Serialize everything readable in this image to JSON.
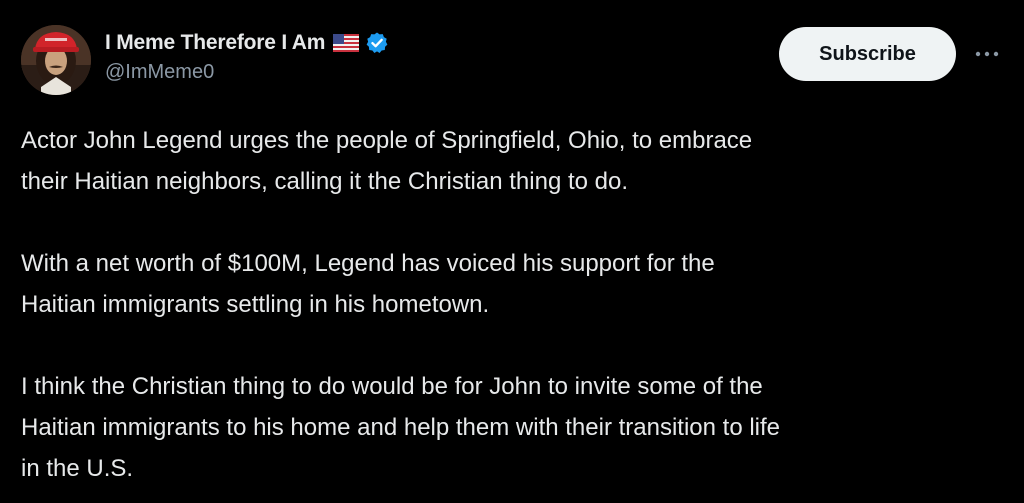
{
  "author": {
    "display_name": "I Meme Therefore I Am",
    "handle": "@ImMeme0",
    "flag_icon": "us-flag-icon",
    "verified_icon": "verified-badge-icon",
    "verified_color": "#1d9bf0"
  },
  "actions": {
    "subscribe_label": "Subscribe",
    "more_icon": "more-horizontal-icon"
  },
  "post": {
    "paragraphs": [
      "Actor John Legend urges the people of Springfield, Ohio, to embrace\ntheir Haitian neighbors, calling it the Christian thing to do.",
      "With a net worth of $100M, Legend has voiced his support for the\nHaitian immigrants settling in his hometown.",
      "I think the Christian thing to do would be for John to invite some of the\nHaitian immigrants to his home and help them with their transition to life\nin the U.S."
    ]
  },
  "colors": {
    "background": "#000000",
    "text_primary": "#e7e9ea",
    "text_secondary": "#8b98a5",
    "button_bg": "#eff3f4",
    "button_text": "#0f1419"
  }
}
